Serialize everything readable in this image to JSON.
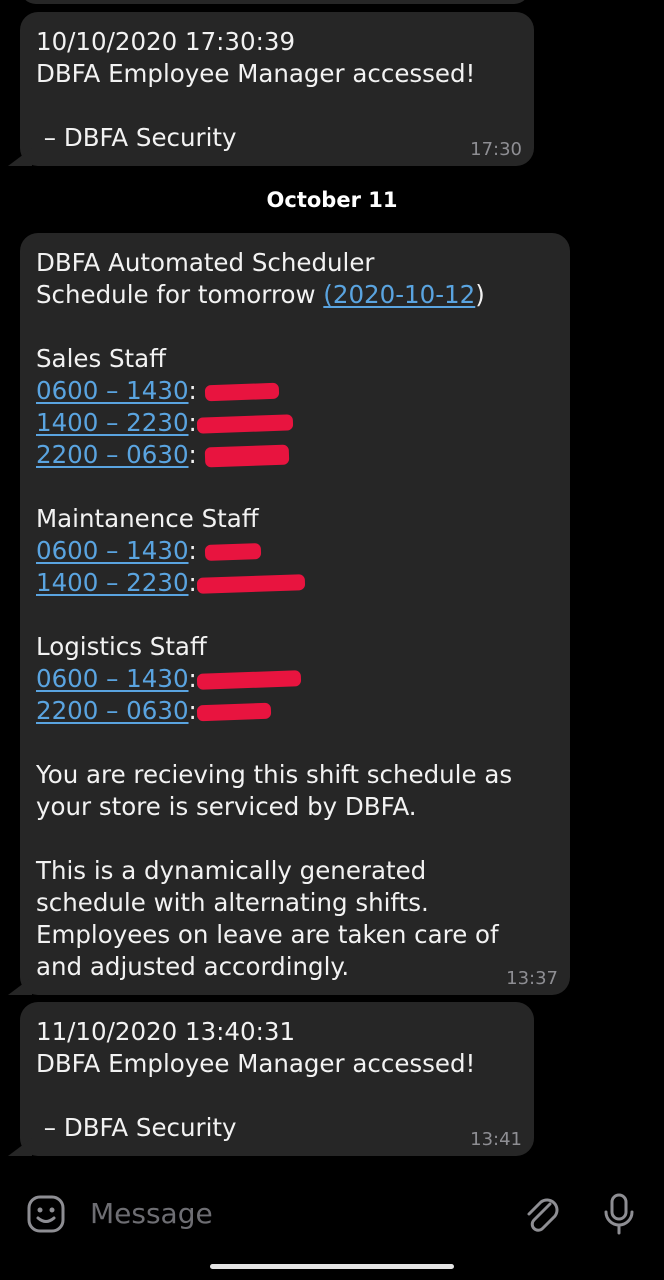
{
  "messages": [
    {
      "lines": [
        "10/10/2020 17:30:39",
        "DBFA Employee Manager accessed!",
        "",
        " – DBFA Security"
      ],
      "time": "17:30"
    },
    {
      "date_separator": "October 11"
    },
    {
      "header": [
        "DBFA Automated Scheduler"
      ],
      "schedule_line_prefix": "Schedule for tomorrow ",
      "schedule_date": "(2020-10-12",
      "schedule_line_suffix": ")",
      "sections": [
        {
          "title": "Sales Staff",
          "shifts": [
            {
              "time": "0600 – 1430",
              "sep": ": "
            },
            {
              "time": "1400 – 2230",
              "sep": ":"
            },
            {
              "time": "2200 – 0630",
              "sep": ": "
            }
          ]
        },
        {
          "title": "Maintanence Staff",
          "shifts": [
            {
              "time": "0600 – 1430",
              "sep": ": "
            },
            {
              "time": "1400 – 2230",
              "sep": ":"
            }
          ]
        },
        {
          "title": "Logistics Staff",
          "shifts": [
            {
              "time": "0600 – 1430",
              "sep": ":"
            },
            {
              "time": "2200 – 0630",
              "sep": ":"
            }
          ]
        }
      ],
      "footer1": [
        "You are recieving this shift schedule as",
        "your store is serviced by DBFA."
      ],
      "footer2": [
        "This is a dynamically generated",
        "schedule with alternating shifts.",
        "Employees on leave are taken care of",
        "and adjusted accordingly."
      ],
      "time": "13:37"
    },
    {
      "lines": [
        "11/10/2020 13:40:31",
        "DBFA Employee Manager accessed!",
        "",
        " – DBFA Security"
      ],
      "time": "13:41"
    }
  ],
  "input": {
    "placeholder": "Message",
    "emoji_icon": "emoji-icon",
    "attach_icon": "paperclip-icon",
    "mic_icon": "microphone-icon"
  },
  "colors": {
    "background": "#000000",
    "bubble": "#262626",
    "link": "#5aa4e0",
    "redaction": "#e8143f",
    "timestamp": "#8e8e93"
  }
}
